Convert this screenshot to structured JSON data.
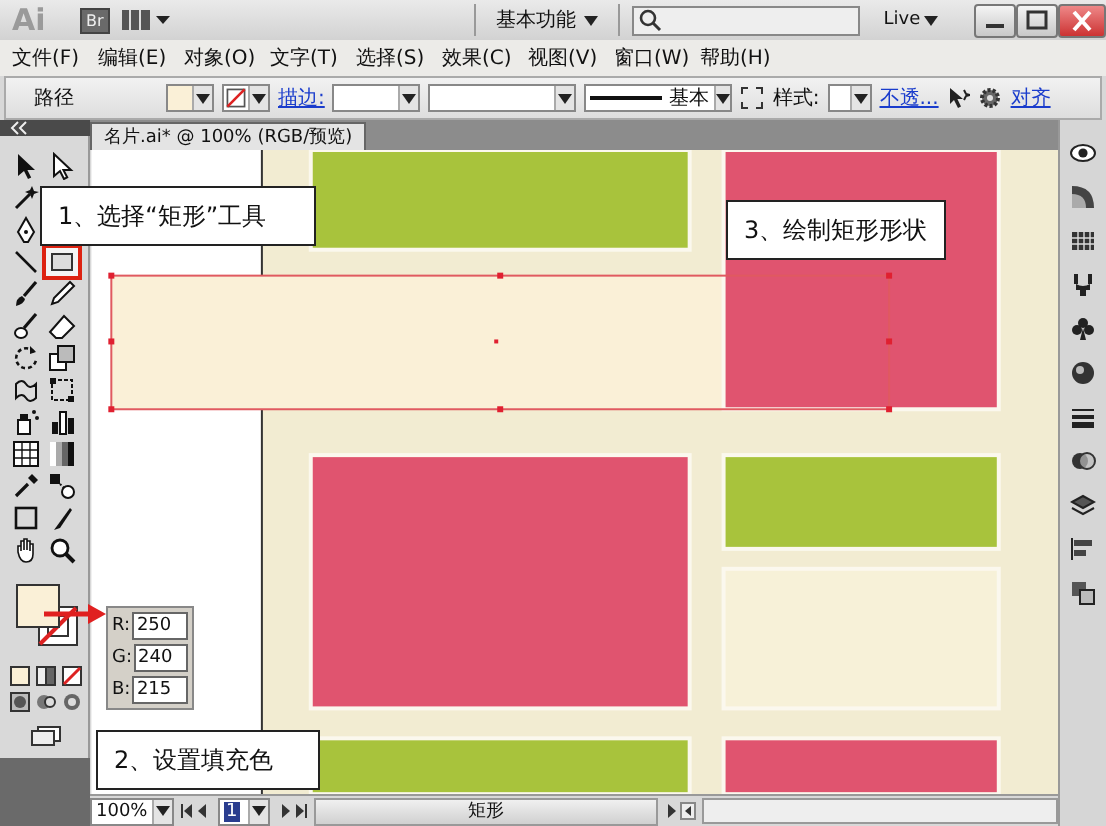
{
  "title_bar": {
    "logo": "Ai",
    "bridge": "Br",
    "workspace": "基本功能",
    "live": "Live"
  },
  "menu": [
    {
      "label": "文件(F)"
    },
    {
      "label": "编辑(E)"
    },
    {
      "label": "对象(O)"
    },
    {
      "label": "文字(T)"
    },
    {
      "label": "选择(S)"
    },
    {
      "label": "效果(C)"
    },
    {
      "label": "视图(V)"
    },
    {
      "label": "窗口(W)"
    },
    {
      "label": "帮助(H)"
    }
  ],
  "control_bar": {
    "selection": "路径",
    "stroke_label": "描边:",
    "profile": "基本",
    "style_label": "样式:",
    "opacity": "不透...",
    "align": "对齐"
  },
  "tool_rows": [
    [
      {
        "kind": "selection",
        "selected": false
      },
      {
        "kind": "direct-selection",
        "selected": false
      }
    ],
    [
      {
        "kind": "magic-wand",
        "selected": false
      }
    ],
    [
      {
        "kind": "pen",
        "selected": false
      }
    ],
    [
      {
        "kind": "line",
        "selected": false
      },
      {
        "kind": "rectangle",
        "selected": true
      }
    ],
    [
      {
        "kind": "paintbrush",
        "selected": false
      },
      {
        "kind": "pencil",
        "selected": false
      }
    ],
    [
      {
        "kind": "blob-brush",
        "selected": false
      },
      {
        "kind": "eraser",
        "selected": false
      }
    ],
    [
      {
        "kind": "rotate",
        "selected": false
      },
      {
        "kind": "scale",
        "selected": false
      }
    ],
    [
      {
        "kind": "warp",
        "selected": false
      },
      {
        "kind": "free-transform",
        "selected": false
      }
    ],
    [
      {
        "kind": "symbol-sprayer",
        "selected": false
      },
      {
        "kind": "graph",
        "selected": false
      }
    ],
    [
      {
        "kind": "mesh",
        "selected": false
      },
      {
        "kind": "gradient",
        "selected": false
      }
    ],
    [
      {
        "kind": "eyedropper",
        "selected": false
      },
      {
        "kind": "blend",
        "selected": false
      }
    ],
    [
      {
        "kind": "artboard",
        "selected": false
      },
      {
        "kind": "slice",
        "selected": false
      }
    ],
    [
      {
        "kind": "hand",
        "selected": false
      },
      {
        "kind": "zoom",
        "selected": false
      }
    ]
  ],
  "fill_color": [
    {
      "label": "R:",
      "value": "250"
    },
    {
      "label": "G:",
      "value": "240"
    },
    {
      "label": "B:",
      "value": "215"
    }
  ],
  "document_tab": {
    "title": "名片.ai* @ 100% (RGB/预览)"
  },
  "new_rectangle": {
    "selected": true
  },
  "cards": [
    {
      "color": "#a8c33c"
    },
    {
      "color": "#e0546f"
    },
    {
      "color": "#e0546f"
    },
    {
      "color": "#a8c33c"
    },
    {
      "color": "#f7f1d8"
    },
    {
      "color": "#a8c33c"
    },
    {
      "color": "#e0546f"
    }
  ],
  "panel_icons": [
    {
      "kind": "appearance"
    },
    {
      "kind": "gradient"
    },
    {
      "kind": "swatches"
    },
    {
      "kind": "brushes"
    },
    {
      "kind": "symbols"
    },
    {
      "kind": "graphic-styles"
    },
    {
      "kind": "stroke"
    },
    {
      "kind": "transparency"
    },
    {
      "kind": "layers"
    },
    {
      "kind": "align"
    },
    {
      "kind": "pathfinder"
    }
  ],
  "callouts": [
    {
      "text": "1、选择“矩形”工具"
    },
    {
      "text": "3、绘制矩形形状"
    },
    {
      "text": "2、设置填充色"
    }
  ],
  "status_bar": {
    "zoom": "100%",
    "page": "1",
    "current_tool": "矩形"
  }
}
